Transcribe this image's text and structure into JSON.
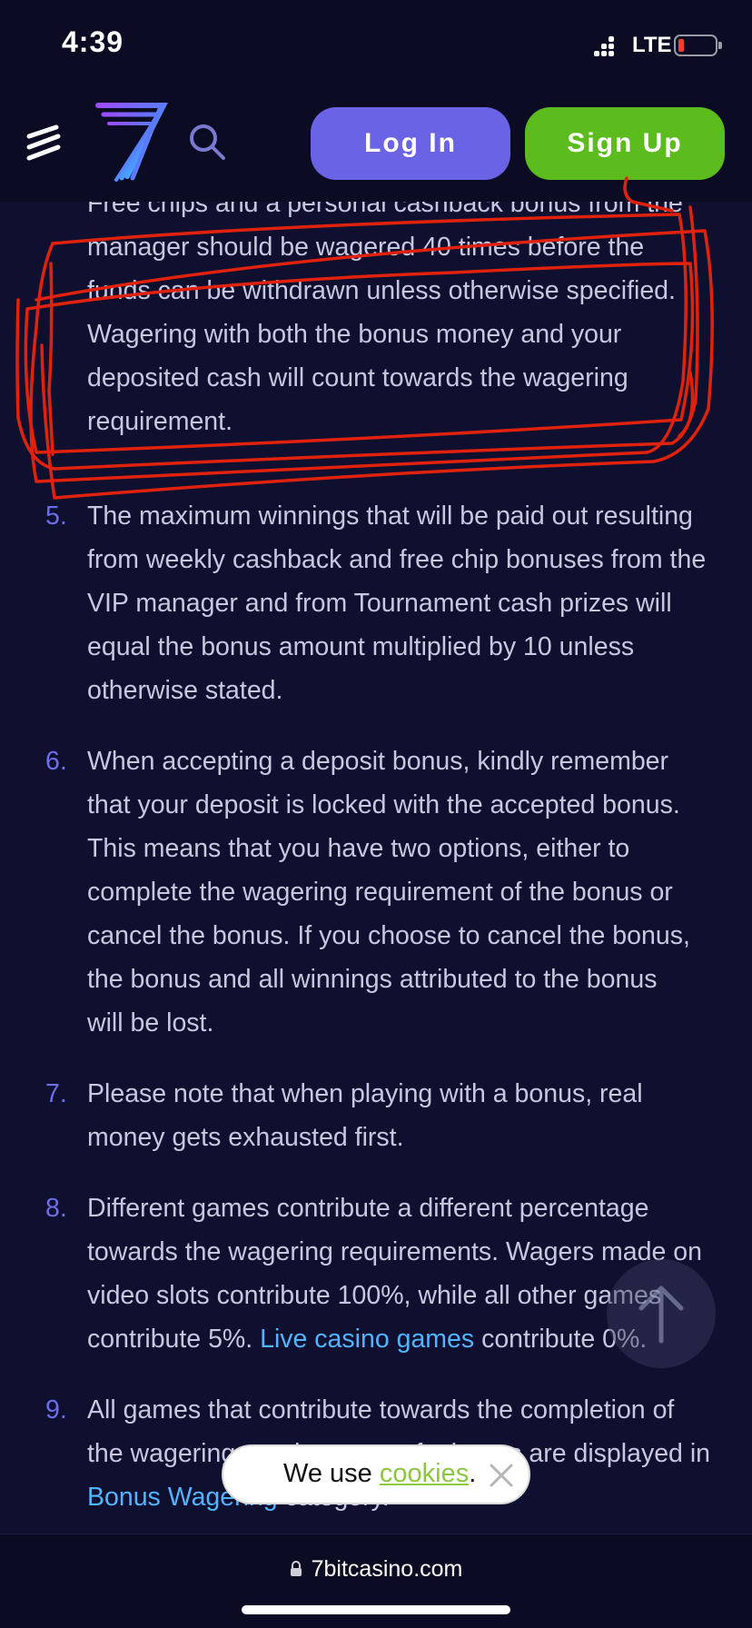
{
  "status_bar": {
    "time": "4:39",
    "network": "LTE"
  },
  "nav": {
    "login_label": "Log In",
    "signup_label": "Sign Up"
  },
  "terms": {
    "item4_lines": [
      "Free chips and a personal cashback bonus from the",
      "manager should be wagered 40 times before the",
      "funds can be withdrawn unless otherwise specified.",
      "Wagering with both the bonus money and your",
      "deposited cash will count towards the wagering",
      "requirement."
    ],
    "items": [
      {
        "number": "5.",
        "lines": [
          "The maximum winnings that will be paid out resulting",
          "from weekly cashback and free chip bonuses from the",
          "VIP manager and from Tournament cash prizes will",
          "equal the bonus amount multiplied by 10 unless",
          "otherwise stated."
        ]
      },
      {
        "number": "6.",
        "lines": [
          "When accepting a deposit bonus, kindly remember",
          "that your deposit is locked with the accepted bonus.",
          "This means that you have two options, either to",
          "complete the wagering requirement of the bonus or",
          "cancel the bonus. If you choose to cancel the bonus,",
          "the bonus and all winnings attributed to the bonus",
          "will be lost."
        ]
      },
      {
        "number": "7.",
        "lines": [
          "Please note that when playing with a bonus, real",
          "money gets exhausted first."
        ]
      },
      {
        "number": "8.",
        "lines": [
          "Different games contribute a different percentage",
          "towards the wagering requirements. Wagers made on",
          "video slots contribute 100%, while all other games"
        ],
        "last_line_before": "contribute 5%. ",
        "last_line_link": "Live casino games",
        "last_line_after": " contribute 0%."
      },
      {
        "number": "9.",
        "lines": [
          "All games that contribute towards the completion of",
          "the wagering requirements of a bonus are displayed in"
        ],
        "last_line_link": "Bonus Wagering",
        "last_line_after": " category."
      }
    ]
  },
  "cookie": {
    "text_before": "We use ",
    "link": "cookies",
    "text_after": "."
  },
  "browser": {
    "url": "7bitcasino.com"
  },
  "colors": {
    "background": "#0f1030",
    "login": "#6a63e6",
    "signup": "#5cbc1e",
    "link": "#52b3ff",
    "number": "#6d6ee8",
    "annotation": "#e0220c"
  },
  "icons": [
    "menu-icon",
    "logo-7bit",
    "search-icon",
    "arrow-up-icon",
    "close-icon",
    "lock-icon"
  ]
}
